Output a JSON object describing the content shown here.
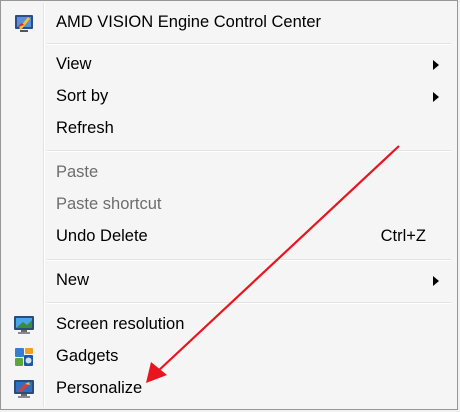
{
  "menu": {
    "items": [
      {
        "label": "AMD VISION Engine Control Center",
        "icon": "amd-vision-icon"
      },
      {
        "label": "View",
        "submenu": true
      },
      {
        "label": "Sort by",
        "submenu": true
      },
      {
        "label": "Refresh"
      },
      {
        "label": "Paste",
        "disabled": true
      },
      {
        "label": "Paste shortcut",
        "disabled": true
      },
      {
        "label": "Undo Delete",
        "shortcut": "Ctrl+Z"
      },
      {
        "label": "New",
        "submenu": true
      },
      {
        "label": "Screen resolution",
        "icon": "screen-resolution-icon"
      },
      {
        "label": "Gadgets",
        "icon": "gadgets-icon"
      },
      {
        "label": "Personalize",
        "icon": "personalize-icon"
      }
    ]
  },
  "annotation": {
    "arrow_color": "#e8141e"
  }
}
